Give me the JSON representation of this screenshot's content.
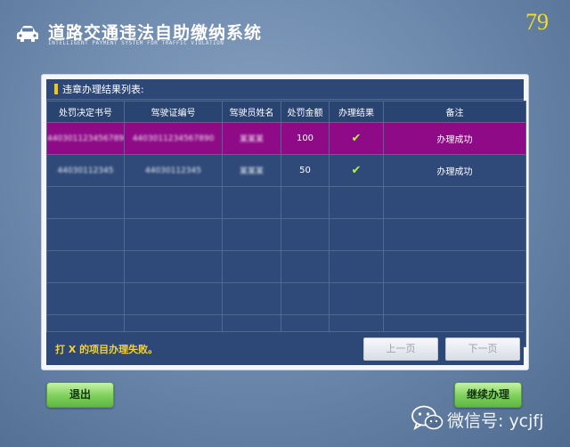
{
  "header": {
    "title": "道路交通违法自助缴纳系统",
    "subtitle": "INTELLIGENT PAYMENT SYSTEM FOR TRAFFIC VIOLATION",
    "countdown": "79",
    "logo_icon": "car-icon"
  },
  "results": {
    "list_title": "违章办理结果列表:",
    "columns": [
      "处罚决定书号",
      "驾驶证编号",
      "驾驶员姓名",
      "处罚金额",
      "办理结果",
      "备注"
    ],
    "rows": [
      {
        "decision_no": "4403011234567890",
        "license_no": "4403011234567890",
        "driver": "某某某",
        "amount": "100",
        "result_icon": "check-icon",
        "note": "办理成功"
      },
      {
        "decision_no": "44030112345",
        "license_no": "44030112345",
        "driver": "某某某",
        "amount": "50",
        "result_icon": "check-icon",
        "note": "办理成功"
      }
    ],
    "empty_row_count": 5
  },
  "footer": {
    "fail_prefix": "打",
    "fail_mark": "X",
    "fail_suffix": "的项目办理失败。",
    "prev_label": "上一页",
    "next_label": "下一页"
  },
  "buttons": {
    "exit_label": "退出",
    "continue_label": "继续办理"
  },
  "watermark": {
    "text": "微信号: ycjfj",
    "icon": "wechat-icon"
  },
  "colors": {
    "highlight_row": "#8e0a87",
    "table_bg": "#2f4a79",
    "countdown": "#f1dd26",
    "button_green": "#7ccf5a",
    "check": "#b7f04a"
  }
}
